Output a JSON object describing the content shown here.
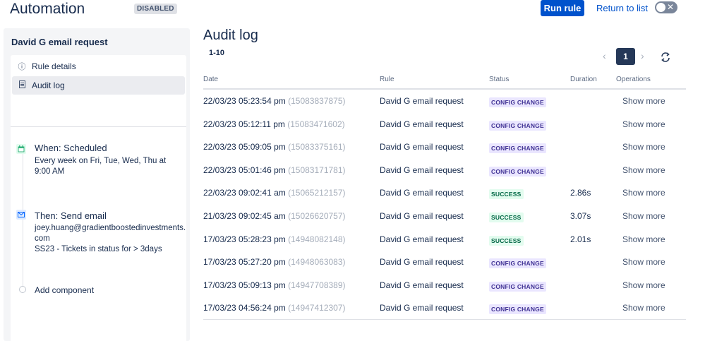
{
  "header": {
    "title": "Automation",
    "status_badge": "DISABLED",
    "run_rule_label": "Run rule",
    "return_label": "Return to list",
    "toggle_symbol": "✕"
  },
  "sidebar": {
    "rule_name": "David G email request",
    "nav": [
      {
        "label": "Rule details",
        "icon": "info-icon"
      },
      {
        "label": "Audit log",
        "icon": "document-icon"
      }
    ],
    "components": [
      {
        "title": "When: Scheduled",
        "desc": "Every week on Fri, Tue, Wed, Thu at 9:00 AM",
        "icon": "calendar-icon",
        "color": "#36b37e"
      },
      {
        "title": "Then: Send email",
        "desc": "joey.huang@gradientboostedinvestments.com\nSS23 - Tickets in status for > 3days",
        "icon": "email-icon",
        "color": "#0065ff"
      }
    ],
    "add_component_label": "Add component"
  },
  "main": {
    "title": "Audit log",
    "range": "1-10",
    "page": "1",
    "columns": {
      "date": "Date",
      "rule": "Rule",
      "status": "Status",
      "duration": "Duration",
      "operations": "Operations"
    },
    "rows": [
      {
        "date": "22/03/23 05:23:54 pm",
        "id": "(15083837875)",
        "rule": "David G email request",
        "status": "CONFIG CHANGE",
        "duration": "",
        "op": "Show more"
      },
      {
        "date": "22/03/23 05:12:11 pm",
        "id": "(15083471602)",
        "rule": "David G email request",
        "status": "CONFIG CHANGE",
        "duration": "",
        "op": "Show more"
      },
      {
        "date": "22/03/23 05:09:05 pm",
        "id": "(15083375161)",
        "rule": "David G email request",
        "status": "CONFIG CHANGE",
        "duration": "",
        "op": "Show more"
      },
      {
        "date": "22/03/23 05:01:46 pm",
        "id": "(15083171781)",
        "rule": "David G email request",
        "status": "CONFIG CHANGE",
        "duration": "",
        "op": "Show more"
      },
      {
        "date": "22/03/23 09:02:41 am",
        "id": "(15065212157)",
        "rule": "David G email request",
        "status": "SUCCESS",
        "duration": "2.86s",
        "op": "Show more"
      },
      {
        "date": "21/03/23 09:02:45 am",
        "id": "(15026620757)",
        "rule": "David G email request",
        "status": "SUCCESS",
        "duration": "3.07s",
        "op": "Show more"
      },
      {
        "date": "17/03/23 05:28:23 pm",
        "id": "(14948082148)",
        "rule": "David G email request",
        "status": "SUCCESS",
        "duration": "2.01s",
        "op": "Show more"
      },
      {
        "date": "17/03/23 05:27:20 pm",
        "id": "(14948063083)",
        "rule": "David G email request",
        "status": "CONFIG CHANGE",
        "duration": "",
        "op": "Show more"
      },
      {
        "date": "17/03/23 05:09:13 pm",
        "id": "(14947708389)",
        "rule": "David G email request",
        "status": "CONFIG CHANGE",
        "duration": "",
        "op": "Show more"
      },
      {
        "date": "17/03/23 04:56:24 pm",
        "id": "(14947412307)",
        "rule": "David G email request",
        "status": "CONFIG CHANGE",
        "duration": "",
        "op": "Show more"
      }
    ]
  }
}
